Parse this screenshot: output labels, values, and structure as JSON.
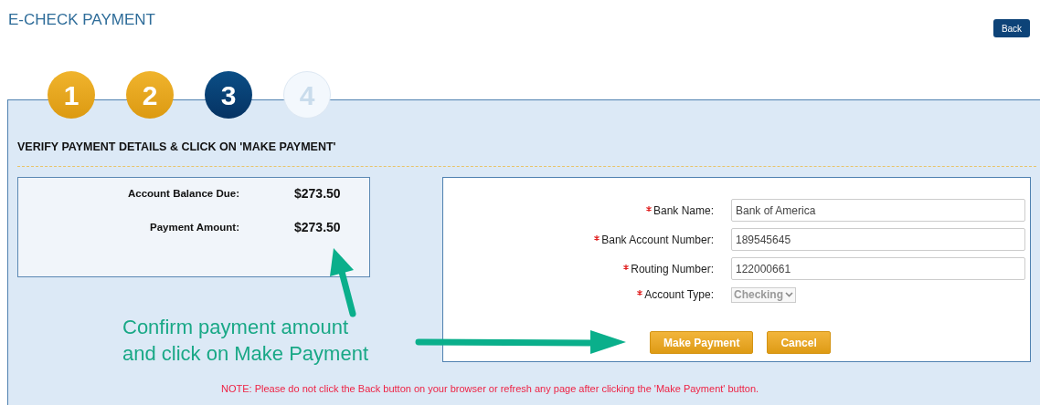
{
  "page_title": "E-CHECK PAYMENT",
  "back_button": "Back",
  "steps": [
    {
      "label": "1",
      "completed": true,
      "selected": false
    },
    {
      "label": "2",
      "completed": true,
      "selected": false
    },
    {
      "label": "3",
      "completed": false,
      "selected": true
    },
    {
      "label": "4",
      "completed": false,
      "selected": false
    }
  ],
  "heading": "VERIFY PAYMENT DETAILS & CLICK ON 'MAKE PAYMENT'",
  "summary": [
    {
      "label": "Account Balance Due:",
      "value": "$273.50"
    },
    {
      "label": "Payment Amount:",
      "value": "$273.50"
    }
  ],
  "form": [
    {
      "kind": "text",
      "label": "Bank Name:",
      "required": true,
      "value": "Bank of America"
    },
    {
      "kind": "text",
      "label": "Bank Account Number:",
      "required": true,
      "value": "189545645"
    },
    {
      "kind": "text",
      "label": "Routing Number:",
      "required": true,
      "value": "122000661"
    },
    {
      "kind": "select",
      "label": "Account Type:",
      "required": true,
      "value": "Checking",
      "disabled": true
    }
  ],
  "buttons": [
    "Make Payment",
    "Cancel"
  ],
  "callout": {
    "lines": [
      "Confirm payment amount",
      "and click on Make Payment"
    ]
  },
  "note": "NOTE: Please do not click the Back button on your browser or refresh any page after clicking the 'Make Payment' button."
}
